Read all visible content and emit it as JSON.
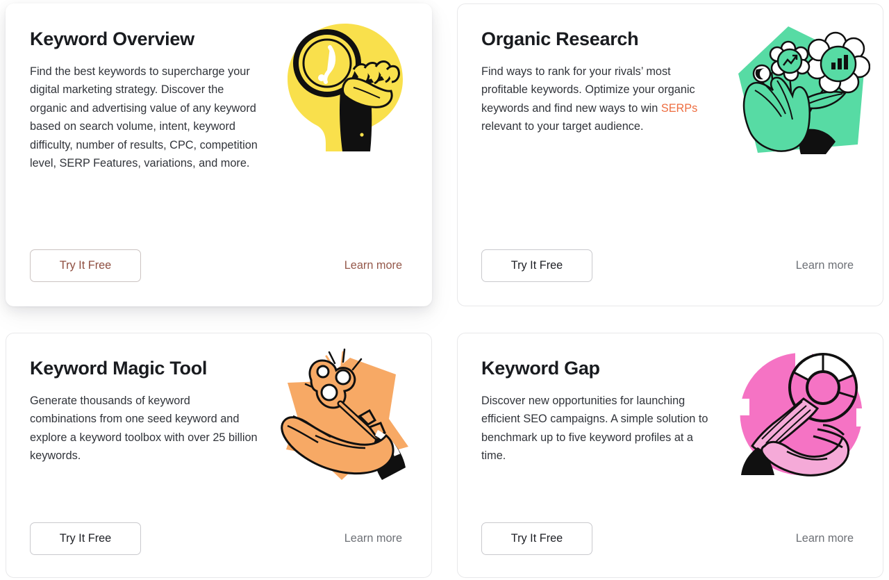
{
  "colors": {
    "accent_orange": "#ee6c3f",
    "hover_text": "#8e4d3f",
    "title": "#191b1f",
    "body": "#31343a",
    "link_muted": "#6d7076",
    "card_border": "#e8e8ea",
    "illustration_yellow": "#f9e04c",
    "illustration_green": "#57dba4",
    "illustration_orange": "#f7a965",
    "illustration_pink": "#f573c4"
  },
  "cards": [
    {
      "id": "keyword-overview",
      "title": "Keyword Overview",
      "description_before_link": "Find the best keywords to supercharge your digital marketing strategy. Discover the organic and advertising value of any keyword based on search volume, intent, keyword difficulty, number of results, CPC, competition level, SERP Features, variations, and more.",
      "link_text": "",
      "description_after_link": "",
      "cta_label": "Try It Free",
      "learn_more_label": "Learn more",
      "illustration": "magnifying-glass-keyhole-illustration",
      "hovered": true
    },
    {
      "id": "organic-research",
      "title": "Organic Research",
      "description_before_link": "Find ways to rank for your rivals’ most profitable keywords. Optimize your organic keywords and find new ways to win ",
      "link_text": "SERPs",
      "description_after_link": " relevant to your target audience.",
      "cta_label": "Try It Free",
      "learn_more_label": "Learn more",
      "illustration": "hand-holding-flowers-illustration",
      "hovered": false
    },
    {
      "id": "keyword-magic-tool",
      "title": "Keyword Magic Tool",
      "description_before_link": "Generate thousands of keyword combinations from one seed keyword and explore a keyword toolbox with over 25 billion keywords.",
      "link_text": "",
      "description_after_link": "",
      "cta_label": "Try It Free",
      "learn_more_label": "Learn more",
      "illustration": "hand-holding-key-star-illustration",
      "hovered": false
    },
    {
      "id": "keyword-gap",
      "title": "Keyword Gap",
      "description_before_link": "Discover new opportunities for launching efficient SEO campaigns. A simple solution to benchmark up to five keyword profiles at a time.",
      "link_text": "",
      "description_after_link": "",
      "cta_label": "Try It Free",
      "learn_more_label": "Learn more",
      "illustration": "hand-holding-pink-key-illustration",
      "hovered": false
    }
  ]
}
